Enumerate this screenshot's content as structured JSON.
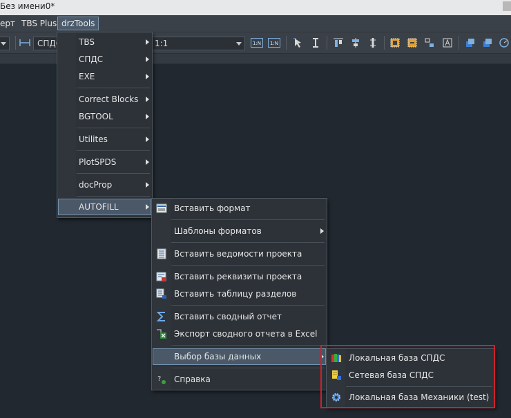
{
  "title": {
    "text": "Без имени0*"
  },
  "menubar": {
    "items": [
      {
        "id": "expert",
        "label": "ерт"
      },
      {
        "id": "tbsplus",
        "label": "TBS Plus"
      },
      {
        "id": "drztools",
        "label": "drzTools"
      }
    ]
  },
  "toolbar": {
    "layer_value": "СПДС",
    "scale_value": "1:1",
    "btn_1n1": "1:N",
    "btn_1n2": "1:N"
  },
  "menu_drz": {
    "items": [
      {
        "label": "TBS"
      },
      {
        "label": "СПДС"
      },
      {
        "label": "EXE"
      },
      {
        "label": "Correct Blocks"
      },
      {
        "label": "BGTOOL"
      },
      {
        "label": "Utilites"
      },
      {
        "label": "PlotSPDS"
      },
      {
        "label": "docProp"
      },
      {
        "label": "AUTOFILL"
      }
    ]
  },
  "menu_autofill": {
    "items": [
      {
        "label": "Вставить формат",
        "icon": "insert-format-icon"
      },
      {
        "label": "Шаблоны форматов",
        "icon": ""
      },
      {
        "label": "Вставить ведомости проекта",
        "icon": "project-sheets-icon"
      },
      {
        "label": "Вставить реквизиты проекта",
        "icon": "project-details-icon"
      },
      {
        "label": "Вставить таблицу разделов",
        "icon": "sections-table-icon"
      },
      {
        "label": "Вставить сводный отчет",
        "icon": "sigma-icon"
      },
      {
        "label": "Экспорт сводного отчета в Excel",
        "icon": "excel-export-icon"
      },
      {
        "label": "Выбор базы данных",
        "icon": ""
      },
      {
        "label": "Справка",
        "icon": "help-icon"
      }
    ]
  },
  "menu_db": {
    "items": [
      {
        "label": "Локальная база СПДС",
        "icon": "local-database-icon"
      },
      {
        "label": "Сетевая база СПДС",
        "icon": "network-database-icon"
      },
      {
        "label": "Локальная база Механики (test)",
        "icon": "gear-database-icon"
      }
    ]
  },
  "colors": {
    "highlight": "#4a5868",
    "annotation_box": "#d0202a"
  }
}
